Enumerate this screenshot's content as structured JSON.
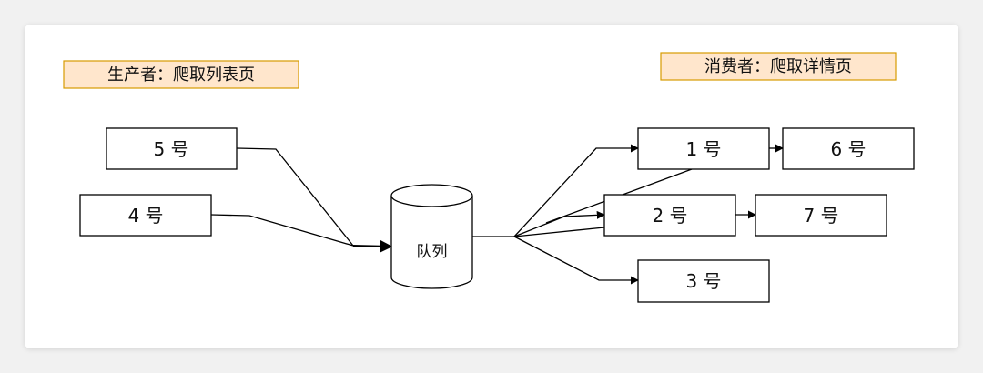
{
  "producer_label": "生产者：爬取列表页",
  "consumer_label": "消费者：爬取详情页",
  "queue_label": "队列",
  "producers": [
    {
      "id": "p5",
      "label": "5 号"
    },
    {
      "id": "p4",
      "label": "4 号"
    }
  ],
  "consumers": [
    {
      "id": "c1",
      "label": "1 号"
    },
    {
      "id": "c2",
      "label": "2 号"
    },
    {
      "id": "c3",
      "label": "3 号"
    }
  ],
  "next_tasks": [
    {
      "id": "n6",
      "label": "6 号"
    },
    {
      "id": "n7",
      "label": "7 号"
    }
  ],
  "colors": {
    "label_fill": "#ffe6cc",
    "label_stroke": "#d79b00",
    "stroke": "#000000"
  }
}
